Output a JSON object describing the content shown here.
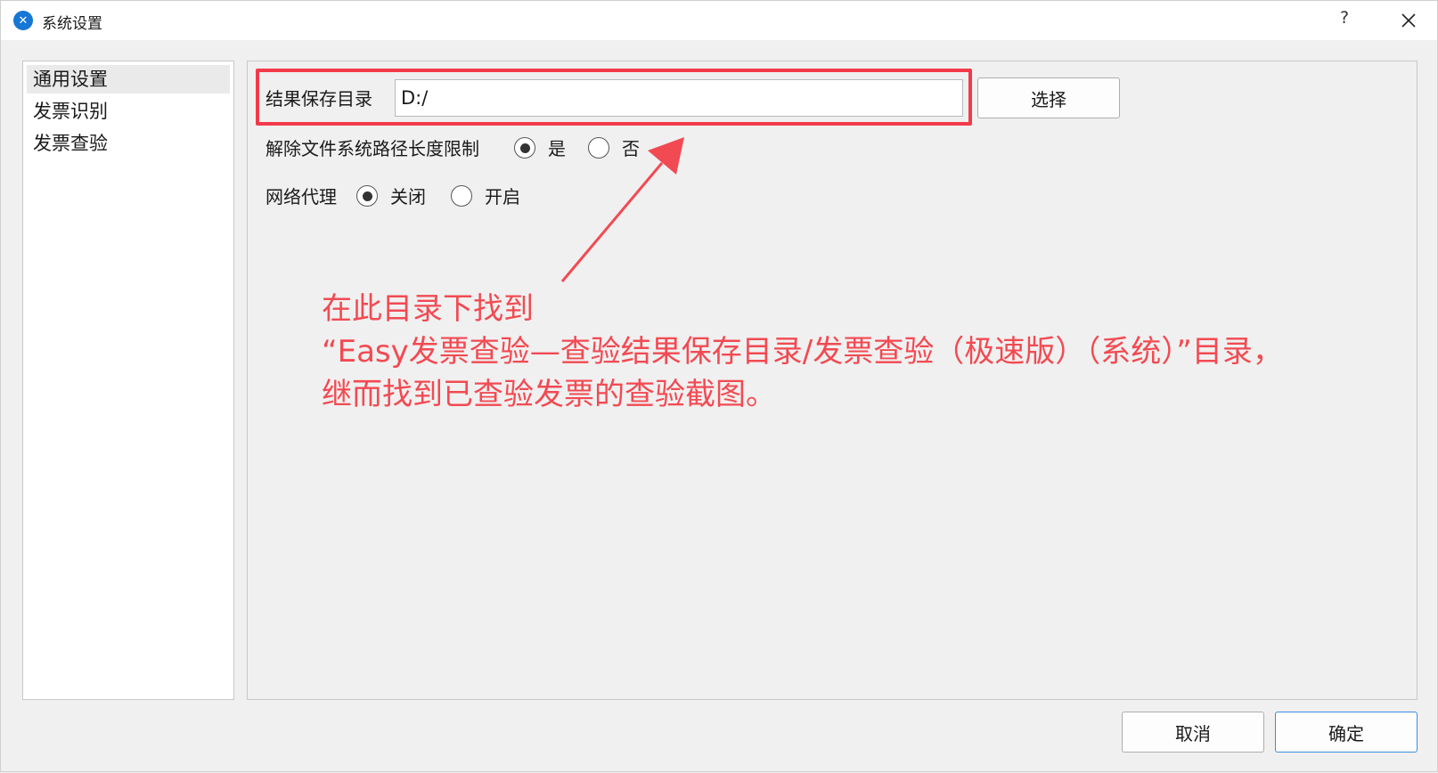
{
  "window": {
    "title": "系统设置",
    "help_label": "?",
    "icons": {
      "app": "app-logo-icon",
      "close": "close-icon"
    }
  },
  "sidebar": {
    "items": [
      {
        "label": "通用设置",
        "selected": true
      },
      {
        "label": "发票识别",
        "selected": false
      },
      {
        "label": "发票查验",
        "selected": false
      }
    ]
  },
  "general": {
    "save_dir_label": "结果保存目录",
    "save_dir_value": "D:/",
    "choose_button": "选择",
    "path_limit_label": "解除文件系统路径长度限制",
    "path_limit_options": [
      "是",
      "否"
    ],
    "path_limit_selected": "是",
    "proxy_label": "网络代理",
    "proxy_options": [
      "关闭",
      "开启"
    ],
    "proxy_selected": "关闭"
  },
  "annotation": {
    "line1": "在此目录下找到",
    "line2": "“Easy发票查验—查验结果保存目录/发票查验（极速版）（系统）”目录，",
    "line3": "继而找到已查验发票的查验截图。",
    "color": "#f24a52"
  },
  "footer": {
    "cancel_button": "取消",
    "ok_button": "确定"
  },
  "colors": {
    "accent": "#1677d4",
    "highlight": "#f23a4a"
  }
}
